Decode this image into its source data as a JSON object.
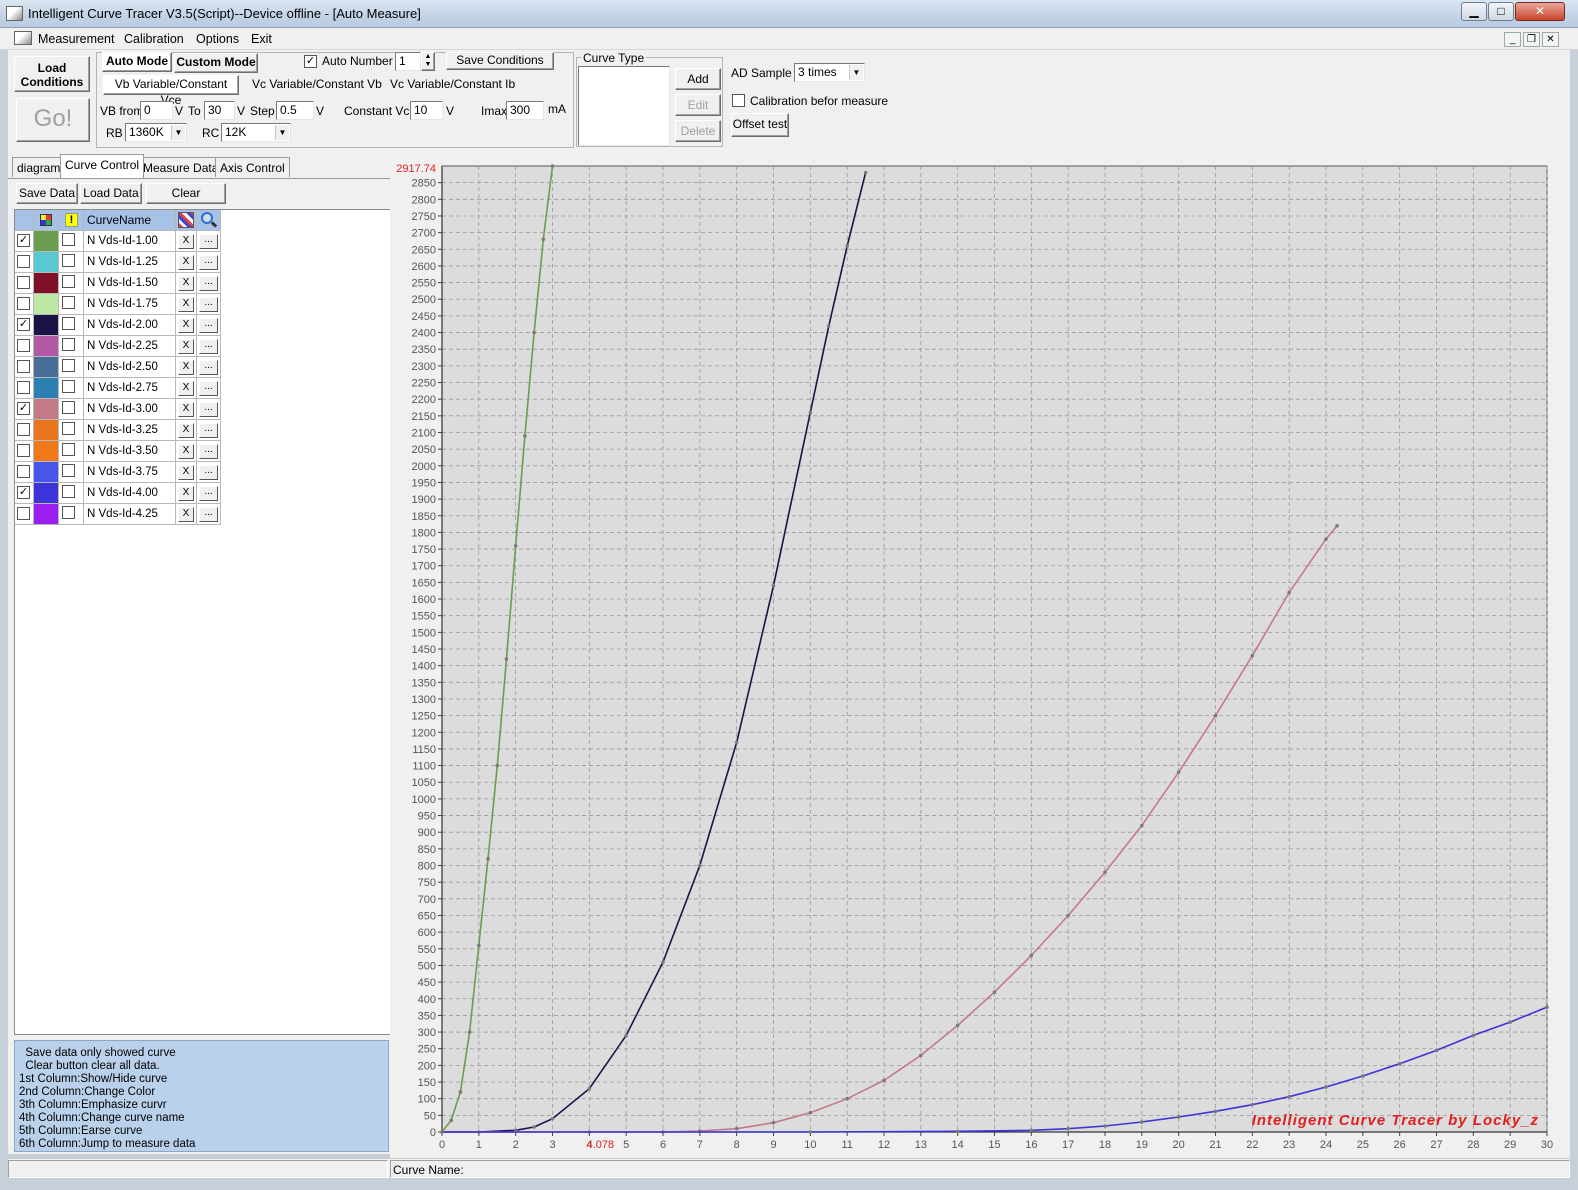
{
  "window": {
    "title": "Intelligent Curve Tracer V3.5(Script)--Device offline - [Auto Measure]",
    "minimize": "▁",
    "maximize": "□",
    "close": "✕"
  },
  "menu": {
    "items": [
      "Measurement",
      "Calibration",
      "Options",
      "Exit"
    ]
  },
  "toolbar": {
    "load_conditions": "Load Conditions",
    "go": "Go!",
    "auto_mode": "Auto Mode",
    "custom_mode": "Custom Mode",
    "auto_number_label": "Auto Number",
    "auto_number_checked": true,
    "auto_number_value": "1",
    "save_conditions": "Save Conditions",
    "mode_tabs": [
      "Vb Variable/Constant Vce",
      "Vc Variable/Constant Vb",
      "Vc Variable/Constant Ib"
    ],
    "vb_from_label": "VB from",
    "vb_from_value": "0",
    "v_unit": "V",
    "to_label": "To",
    "to_value": "30",
    "step_label": "Step",
    "step_value": "0.5",
    "constant_vce_label": "Constant Vce",
    "constant_vce_value": "10",
    "imax_label": "Imax",
    "imax_value": "300",
    "ma_unit": "mA",
    "rb_label": "RB",
    "rb_value": "1360K",
    "rc_label": "RC",
    "rc_value": "12K",
    "curve_type_label": "Curve Type",
    "add": "Add",
    "edit": "Edit",
    "delete": "Delete",
    "ad_sample_label": "AD Sample",
    "ad_sample_value": "3 times",
    "calibration_label": "Calibration befor measure",
    "calibration_checked": false,
    "offset_test": "Offset test"
  },
  "left_tabs": [
    "diagram",
    "Curve Control",
    "Measure Data",
    "Axis Control"
  ],
  "left_tab_active": 1,
  "curve_control": {
    "save_data": "Save Data",
    "load_data": "Load Data",
    "clear": "Clear",
    "header_name": "CurveName",
    "header_emphasize": "!",
    "remove_label": "X",
    "more_label": "...",
    "curves": [
      {
        "name": "N Vds-Id-1.00",
        "shown": true,
        "color": "#6a9e4e"
      },
      {
        "name": "N Vds-Id-1.25",
        "shown": false,
        "color": "#5ac8d2"
      },
      {
        "name": "N Vds-Id-1.50",
        "shown": false,
        "color": "#7e1028"
      },
      {
        "name": "N Vds-Id-1.75",
        "shown": false,
        "color": "#bfe8a6"
      },
      {
        "name": "N Vds-Id-2.00",
        "shown": true,
        "color": "#1a1446"
      },
      {
        "name": "N Vds-Id-2.25",
        "shown": false,
        "color": "#b05aa6"
      },
      {
        "name": "N Vds-Id-2.50",
        "shown": false,
        "color": "#4a6e9a"
      },
      {
        "name": "N Vds-Id-2.75",
        "shown": false,
        "color": "#2a80b0"
      },
      {
        "name": "N Vds-Id-3.00",
        "shown": true,
        "color": "#c47a86"
      },
      {
        "name": "N Vds-Id-3.25",
        "shown": false,
        "color": "#e8761e"
      },
      {
        "name": "N Vds-Id-3.50",
        "shown": false,
        "color": "#f07a18"
      },
      {
        "name": "N Vds-Id-3.75",
        "shown": false,
        "color": "#4656e6"
      },
      {
        "name": "N Vds-Id-4.00",
        "shown": true,
        "color": "#3c34d8"
      },
      {
        "name": "N Vds-Id-4.25",
        "shown": false,
        "color": "#9a1ef0"
      }
    ]
  },
  "help_text": [
    "  Save data only showed curve",
    "  Clear button clear all data.",
    "1st Column:Show/Hide curve",
    "2nd Column:Change Color",
    "3th Column:Emphasize curvr",
    "4th Column:Change curve name",
    "5th Column:Earse curve",
    "6th Column:Jump to measure data"
  ],
  "chart_data": {
    "type": "line",
    "xlim": [
      0,
      30
    ],
    "ylim": [
      0,
      2900
    ],
    "x_ticks": [
      0,
      1,
      2,
      3,
      4,
      5,
      6,
      7,
      8,
      9,
      10,
      11,
      12,
      13,
      14,
      15,
      16,
      17,
      18,
      19,
      20,
      21,
      22,
      23,
      24,
      25,
      26,
      27,
      28,
      29,
      30
    ],
    "y_ticks": [
      0,
      50,
      100,
      150,
      200,
      250,
      300,
      350,
      400,
      450,
      500,
      550,
      600,
      650,
      700,
      750,
      800,
      850,
      900,
      950,
      1000,
      1050,
      1100,
      1150,
      1200,
      1250,
      1300,
      1350,
      1400,
      1450,
      1500,
      1550,
      1600,
      1650,
      1700,
      1750,
      1800,
      1850,
      1900,
      1950,
      2000,
      2050,
      2100,
      2150,
      2200,
      2250,
      2300,
      2350,
      2400,
      2450,
      2500,
      2550,
      2600,
      2650,
      2700,
      2750,
      2800,
      2850
    ],
    "y_max_readout": "2917.74",
    "x_cursor_readout": "4.078",
    "grid": true,
    "watermark": "Intelligent Curve Tracer by Locky_z",
    "series": [
      {
        "name": "N Vds-Id-1.00",
        "color": "#6a9e4e",
        "x": [
          0,
          0.25,
          0.5,
          0.75,
          1,
          1.25,
          1.5,
          1.75,
          2,
          2.25,
          2.5,
          2.75,
          3
        ],
        "y": [
          0,
          35,
          120,
          300,
          560,
          820,
          1100,
          1420,
          1760,
          2090,
          2400,
          2680,
          2900
        ]
      },
      {
        "name": "N Vds-Id-2.00",
        "color": "#1a1446",
        "x": [
          0,
          1,
          2,
          2.5,
          3,
          4,
          5,
          6,
          7,
          8,
          9,
          10,
          10.5,
          11,
          11.5
        ],
        "y": [
          0,
          0,
          5,
          15,
          40,
          130,
          290,
          510,
          800,
          1170,
          1640,
          2160,
          2420,
          2660,
          2880
        ]
      },
      {
        "name": "N Vds-Id-3.00",
        "color": "#c47a86",
        "x": [
          0,
          4,
          6,
          7,
          8,
          9,
          10,
          11,
          12,
          13,
          14,
          15,
          16,
          17,
          18,
          19,
          20,
          21,
          22,
          23,
          24,
          24.3
        ],
        "y": [
          0,
          0,
          0,
          3,
          10,
          28,
          58,
          100,
          155,
          230,
          320,
          420,
          530,
          650,
          780,
          920,
          1080,
          1250,
          1430,
          1620,
          1780,
          1820
        ]
      },
      {
        "name": "N Vds-Id-4.00",
        "color": "#3c34d8",
        "x": [
          0,
          10,
          14,
          16,
          17,
          18,
          19,
          20,
          21,
          22,
          23,
          24,
          25,
          26,
          27,
          28,
          29,
          30
        ],
        "y": [
          0,
          0,
          2,
          5,
          10,
          18,
          30,
          45,
          62,
          82,
          106,
          135,
          168,
          205,
          245,
          290,
          330,
          375
        ]
      }
    ]
  },
  "status": {
    "curve_name_label": "Curve Name:",
    "left_cell": ""
  }
}
